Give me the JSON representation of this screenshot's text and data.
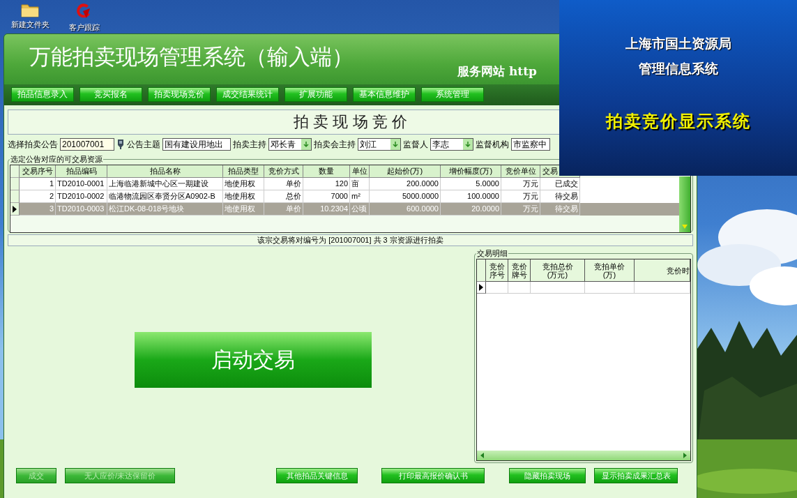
{
  "desktop": {
    "icons": [
      {
        "label": "新建文件夹",
        "kind": "folder"
      },
      {
        "label": "客户跟踪",
        "kind": "app"
      }
    ]
  },
  "main_window": {
    "title": "万能拍卖现场管理系统（输入端）",
    "website_label": "服务网站 http",
    "menu": [
      "拍品信息录入",
      "竞买报名",
      "拍卖现场竞价",
      "成交结果统计",
      "扩展功能",
      "基本信息维护",
      "系统管理"
    ],
    "page_title": "拍 卖 现 场 竞 价",
    "form": [
      {
        "label": "选择拍卖公告",
        "value": "201007001",
        "kind": "text",
        "lookup_button": true
      },
      {
        "label": "公告主题",
        "value": "国有建设用地出",
        "kind": "text",
        "lookup_button": false
      },
      {
        "label": "拍卖主持",
        "value": "邓长青",
        "kind": "combo",
        "lookup_button": false
      },
      {
        "label": "拍卖会主持",
        "value": "刘江",
        "kind": "combo",
        "lookup_button": false
      },
      {
        "label": "监督人",
        "value": "李志",
        "kind": "combo",
        "lookup_button": false
      },
      {
        "label": "监督机构",
        "value": "市监察中",
        "kind": "text",
        "lookup_button": false
      }
    ],
    "resources": {
      "legend": "选定公告对应的可交易资源",
      "columns": [
        "交易序号",
        "拍品编码",
        "拍品名称",
        "拍品类型",
        "竞价方式",
        "数量",
        "单位",
        "起始价(万)",
        "增价幅度(万)",
        "竞价单位",
        "交易"
      ],
      "rows": [
        {
          "selected": false,
          "cells": [
            "1",
            "TD2010-0001",
            "上海临港新城中心区一期建设",
            "地使用权",
            "单价",
            "120",
            "亩",
            "200.0000",
            "5.0000",
            "万元",
            "已成交"
          ]
        },
        {
          "selected": false,
          "cells": [
            "2",
            "TD2010-0002",
            "临港物流园区奉贤分区A0902-B",
            "地使用权",
            "总价",
            "7000",
            "m²",
            "5000.0000",
            "100.0000",
            "万元",
            "待交易"
          ]
        },
        {
          "selected": true,
          "cells": [
            "3",
            "TD2010-0003",
            "松江DK-08-018号地块",
            "地使用权",
            "单价",
            "10.2304",
            "公顷",
            "600.0000",
            "20.0000",
            "万元",
            "待交易"
          ]
        }
      ]
    },
    "status_text": "该宗交易将对编号为 [201007001] 共 3 宗资源进行拍卖",
    "start_button": "启动交易",
    "detail": {
      "legend": "交易明细",
      "columns": [
        [
          "竞价",
          "序号"
        ],
        [
          "竞价",
          "牌号"
        ],
        [
          "竞拍总价",
          "(万元)"
        ],
        [
          "竞拍单价",
          "(万)"
        ],
        [
          "竞价时"
        ]
      ]
    },
    "bottom_buttons": [
      {
        "label": "成交",
        "disabled": true
      },
      {
        "label": "无人应价/未达保留价",
        "disabled": true
      },
      {
        "label": "其他拍品关键信息",
        "disabled": false
      },
      {
        "label": "打印最高报价确认书",
        "disabled": false
      },
      {
        "label": "隐藏拍卖现场",
        "disabled": false
      },
      {
        "label": "显示拍卖成果汇总表",
        "disabled": false
      }
    ]
  },
  "display_window": {
    "organization": "上海市国土资源局",
    "subtitle": "管理信息系统",
    "heading": "拍卖竞价显示系统"
  }
}
